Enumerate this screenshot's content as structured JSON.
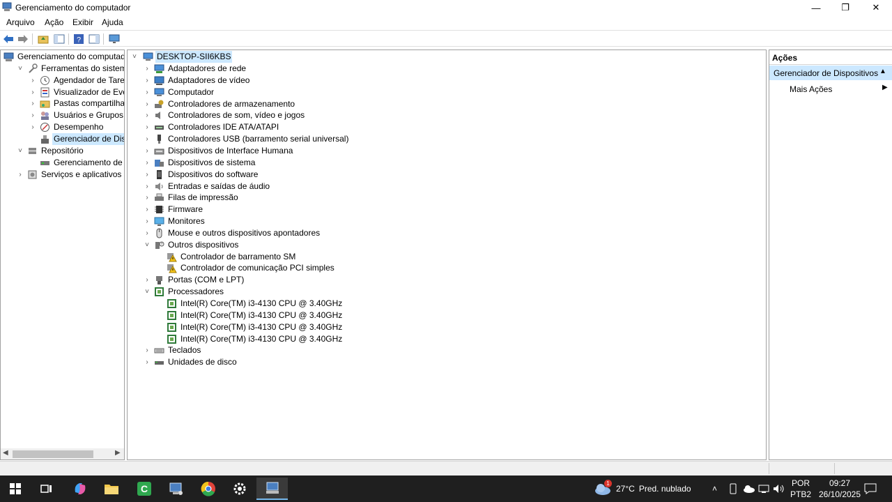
{
  "window": {
    "title": "Gerenciamento do computador",
    "minimize": "—",
    "restore": "❐",
    "close": "✕"
  },
  "menu": [
    "Arquivo",
    "Ação",
    "Exibir",
    "Ajuda"
  ],
  "left_tree": [
    {
      "label": "Gerenciamento do computado",
      "level": 0,
      "chevron": "",
      "icon": "computer-management-icon"
    },
    {
      "label": "Ferramentas do sistema",
      "level": 1,
      "chevron": "˅",
      "icon": "tools-icon"
    },
    {
      "label": "Agendador de Tarefas",
      "level": 2,
      "chevron": "›",
      "icon": "clock-icon"
    },
    {
      "label": "Visualizador de Eventos",
      "level": 2,
      "chevron": "›",
      "icon": "event-viewer-icon"
    },
    {
      "label": "Pastas compartilhadas",
      "level": 2,
      "chevron": "›",
      "icon": "shared-folder-icon"
    },
    {
      "label": "Usuários e Grupos Loca",
      "level": 2,
      "chevron": "›",
      "icon": "users-icon"
    },
    {
      "label": "Desempenho",
      "level": 2,
      "chevron": "›",
      "icon": "performance-icon"
    },
    {
      "label": "Gerenciador de Disposit",
      "level": 2,
      "chevron": "",
      "icon": "device-manager-icon",
      "selected": true
    },
    {
      "label": "Repositório",
      "level": 1,
      "chevron": "˅",
      "icon": "storage-icon"
    },
    {
      "label": "Gerenciamento de disco",
      "level": 2,
      "chevron": "",
      "icon": "disk-icon"
    },
    {
      "label": "Serviços e aplicativos",
      "level": 1,
      "chevron": "›",
      "icon": "services-icon"
    }
  ],
  "device_tree": {
    "root": "DESKTOP-SII6KBS",
    "items": [
      {
        "label": "Adaptadores de rede",
        "level": 1,
        "chevron": "›",
        "icon": "network-adapter-icon"
      },
      {
        "label": "Adaptadores de vídeo",
        "level": 1,
        "chevron": "›",
        "icon": "display-adapter-icon"
      },
      {
        "label": "Computador",
        "level": 1,
        "chevron": "›",
        "icon": "computer-icon"
      },
      {
        "label": "Controladores de armazenamento",
        "level": 1,
        "chevron": "›",
        "icon": "storage-controller-icon"
      },
      {
        "label": "Controladores de som, vídeo e jogos",
        "level": 1,
        "chevron": "›",
        "icon": "sound-icon"
      },
      {
        "label": "Controladores IDE ATA/ATAPI",
        "level": 1,
        "chevron": "›",
        "icon": "ide-icon"
      },
      {
        "label": "Controladores USB (barramento serial universal)",
        "level": 1,
        "chevron": "›",
        "icon": "usb-icon"
      },
      {
        "label": "Dispositivos de Interface Humana",
        "level": 1,
        "chevron": "›",
        "icon": "hid-icon"
      },
      {
        "label": "Dispositivos de sistema",
        "level": 1,
        "chevron": "›",
        "icon": "system-devices-icon"
      },
      {
        "label": "Dispositivos do software",
        "level": 1,
        "chevron": "›",
        "icon": "software-device-icon"
      },
      {
        "label": "Entradas e saídas de áudio",
        "level": 1,
        "chevron": "›",
        "icon": "audio-io-icon"
      },
      {
        "label": "Filas de impressão",
        "level": 1,
        "chevron": "›",
        "icon": "printer-icon"
      },
      {
        "label": "Firmware",
        "level": 1,
        "chevron": "›",
        "icon": "firmware-icon"
      },
      {
        "label": "Monitores",
        "level": 1,
        "chevron": "›",
        "icon": "monitor-icon"
      },
      {
        "label": "Mouse e outros dispositivos apontadores",
        "level": 1,
        "chevron": "›",
        "icon": "mouse-icon"
      },
      {
        "label": "Outros dispositivos",
        "level": 1,
        "chevron": "˅",
        "icon": "other-devices-icon"
      },
      {
        "label": "Controlador de barramento SM",
        "level": 2,
        "chevron": "",
        "icon": "warning-device-icon"
      },
      {
        "label": "Controlador de comunicação PCI simples",
        "level": 2,
        "chevron": "",
        "icon": "warning-device-icon"
      },
      {
        "label": "Portas (COM e LPT)",
        "level": 1,
        "chevron": "›",
        "icon": "port-icon"
      },
      {
        "label": "Processadores",
        "level": 1,
        "chevron": "˅",
        "icon": "processor-icon"
      },
      {
        "label": "Intel(R) Core(TM) i3-4130 CPU @ 3.40GHz",
        "level": 2,
        "chevron": "",
        "icon": "processor-icon"
      },
      {
        "label": "Intel(R) Core(TM) i3-4130 CPU @ 3.40GHz",
        "level": 2,
        "chevron": "",
        "icon": "processor-icon"
      },
      {
        "label": "Intel(R) Core(TM) i3-4130 CPU @ 3.40GHz",
        "level": 2,
        "chevron": "",
        "icon": "processor-icon"
      },
      {
        "label": "Intel(R) Core(TM) i3-4130 CPU @ 3.40GHz",
        "level": 2,
        "chevron": "",
        "icon": "processor-icon"
      },
      {
        "label": "Teclados",
        "level": 1,
        "chevron": "›",
        "icon": "keyboard-icon"
      },
      {
        "label": "Unidades de disco",
        "level": 1,
        "chevron": "›",
        "icon": "disk-drive-icon"
      }
    ]
  },
  "actions": {
    "header": "Ações",
    "section": "Gerenciador de Dispositivos",
    "more": "Mais Ações"
  },
  "taskbar": {
    "weather_temp": "27°C",
    "weather_desc": "Pred. nublado",
    "weather_badge": "1",
    "lang_top": "POR",
    "lang_bottom": "PTB2",
    "time": "09:27",
    "date": "26/10/2025"
  },
  "colors": {
    "selection": "#cce8ff",
    "actions_section": "#cce8ff",
    "taskbar": "#1f1f1f"
  }
}
